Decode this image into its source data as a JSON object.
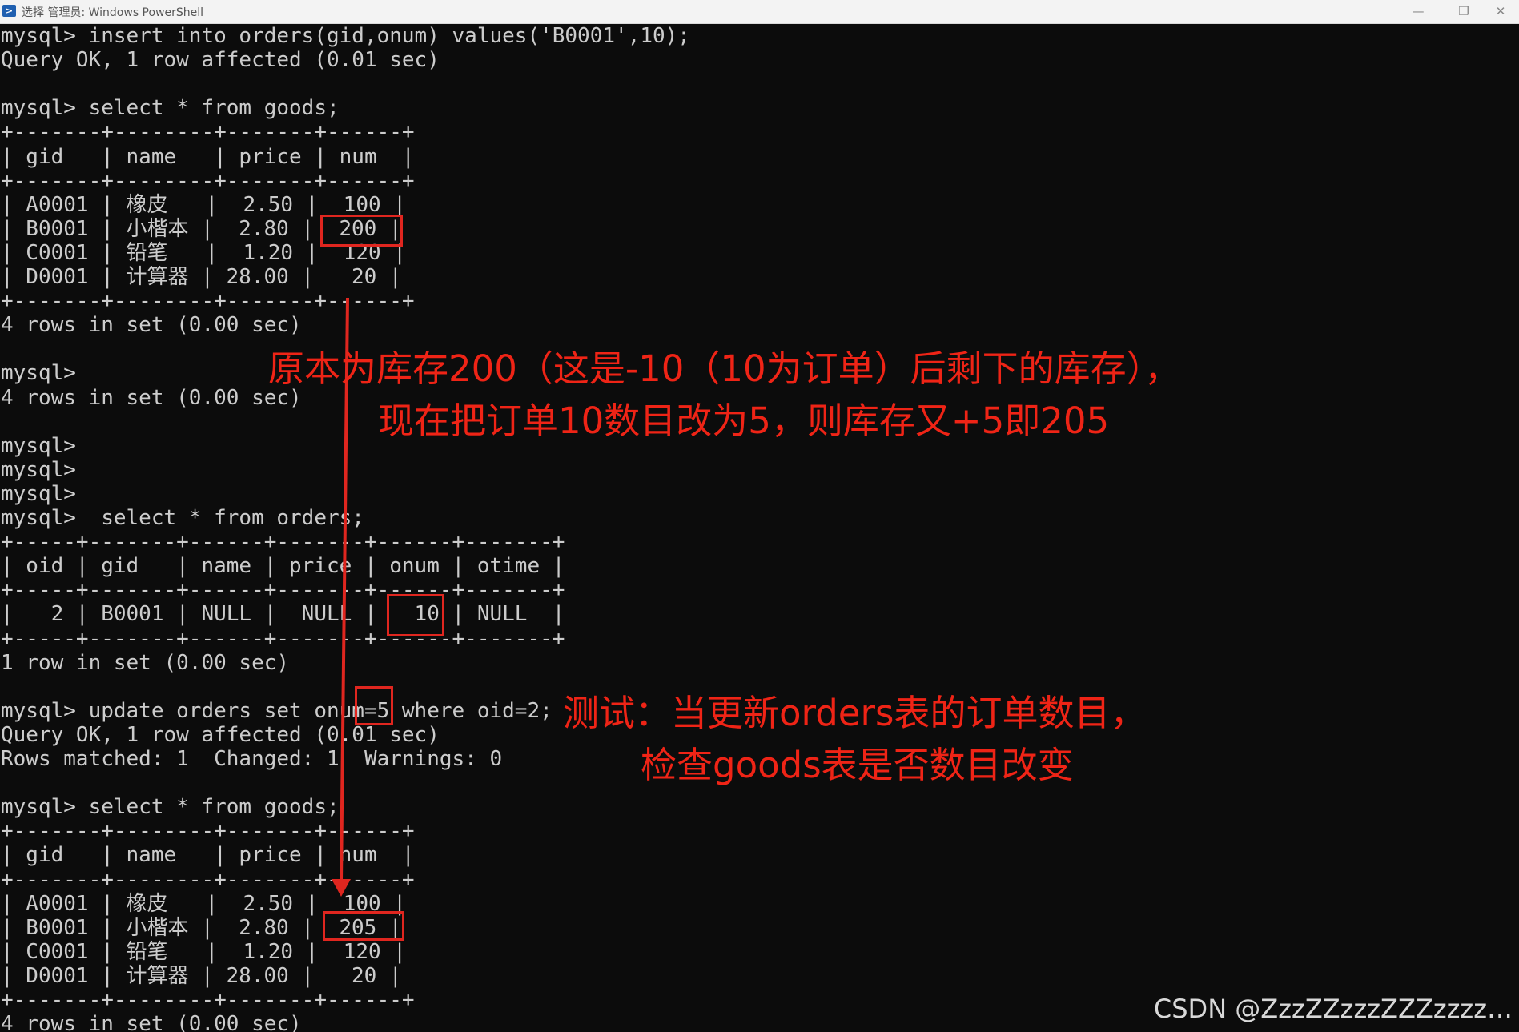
{
  "window": {
    "title": "选择 管理员: Windows PowerShell",
    "icon": "powershell-icon",
    "controls": {
      "minimize": "—",
      "maximize": "❐",
      "close": "✕"
    }
  },
  "console": {
    "lines": [
      "mysql> insert into orders(gid,onum) values('B0001',10);",
      "Query OK, 1 row affected (0.01 sec)",
      "",
      "mysql> select * from goods;",
      "+-------+--------+-------+------+",
      "| gid   | name   | price | num  |",
      "+-------+--------+-------+------+",
      "| A0001 | 橡皮   |  2.50 |  100 |",
      "| B0001 | 小楷本 |  2.80 |  200 |",
      "| C0001 | 铅笔   |  1.20 |  120 |",
      "| D0001 | 计算器 | 28.00 |   20 |",
      "+-------+--------+-------+------+",
      "4 rows in set (0.00 sec)",
      "",
      "mysql>",
      "4 rows in set (0.00 sec)",
      "",
      "mysql>",
      "mysql>",
      "mysql>",
      "mysql>  select * from orders;",
      "+-----+-------+------+-------+------+-------+",
      "| oid | gid   | name | price | onum | otime |",
      "+-----+-------+------+-------+------+-------+",
      "|   2 | B0001 | NULL |  NULL |   10 | NULL  |",
      "+-----+-------+------+-------+------+-------+",
      "1 row in set (0.00 sec)",
      "",
      "mysql> update orders set onum=5 where oid=2;",
      "Query OK, 1 row affected (0.01 sec)",
      "Rows matched: 1  Changed: 1  Warnings: 0",
      "",
      "mysql> select * from goods;",
      "+-------+--------+-------+------+",
      "| gid   | name   | price | num  |",
      "+-------+--------+-------+------+",
      "| A0001 | 橡皮   |  2.50 |  100 |",
      "| B0001 | 小楷本 |  2.80 |  205 |",
      "| C0001 | 铅笔   |  1.20 |  120 |",
      "| D0001 | 计算器 | 28.00 |   20 |",
      "+-------+--------+-------+------+",
      "4 rows in set (0.00 sec)"
    ]
  },
  "annotations": {
    "note1": {
      "line1": "原本为库存200（这是-10（10为订单）后剩下的库存），",
      "line2": "现在把订单10数目改为5，则库存又+5即205"
    },
    "note2": {
      "line1": "测试：当更新orders表的订单数目，",
      "line2": "检查goods表是否数目改变"
    },
    "color": "#ef2416"
  },
  "watermark": "CSDN @ZzzZZzzzZZZzzzz…"
}
